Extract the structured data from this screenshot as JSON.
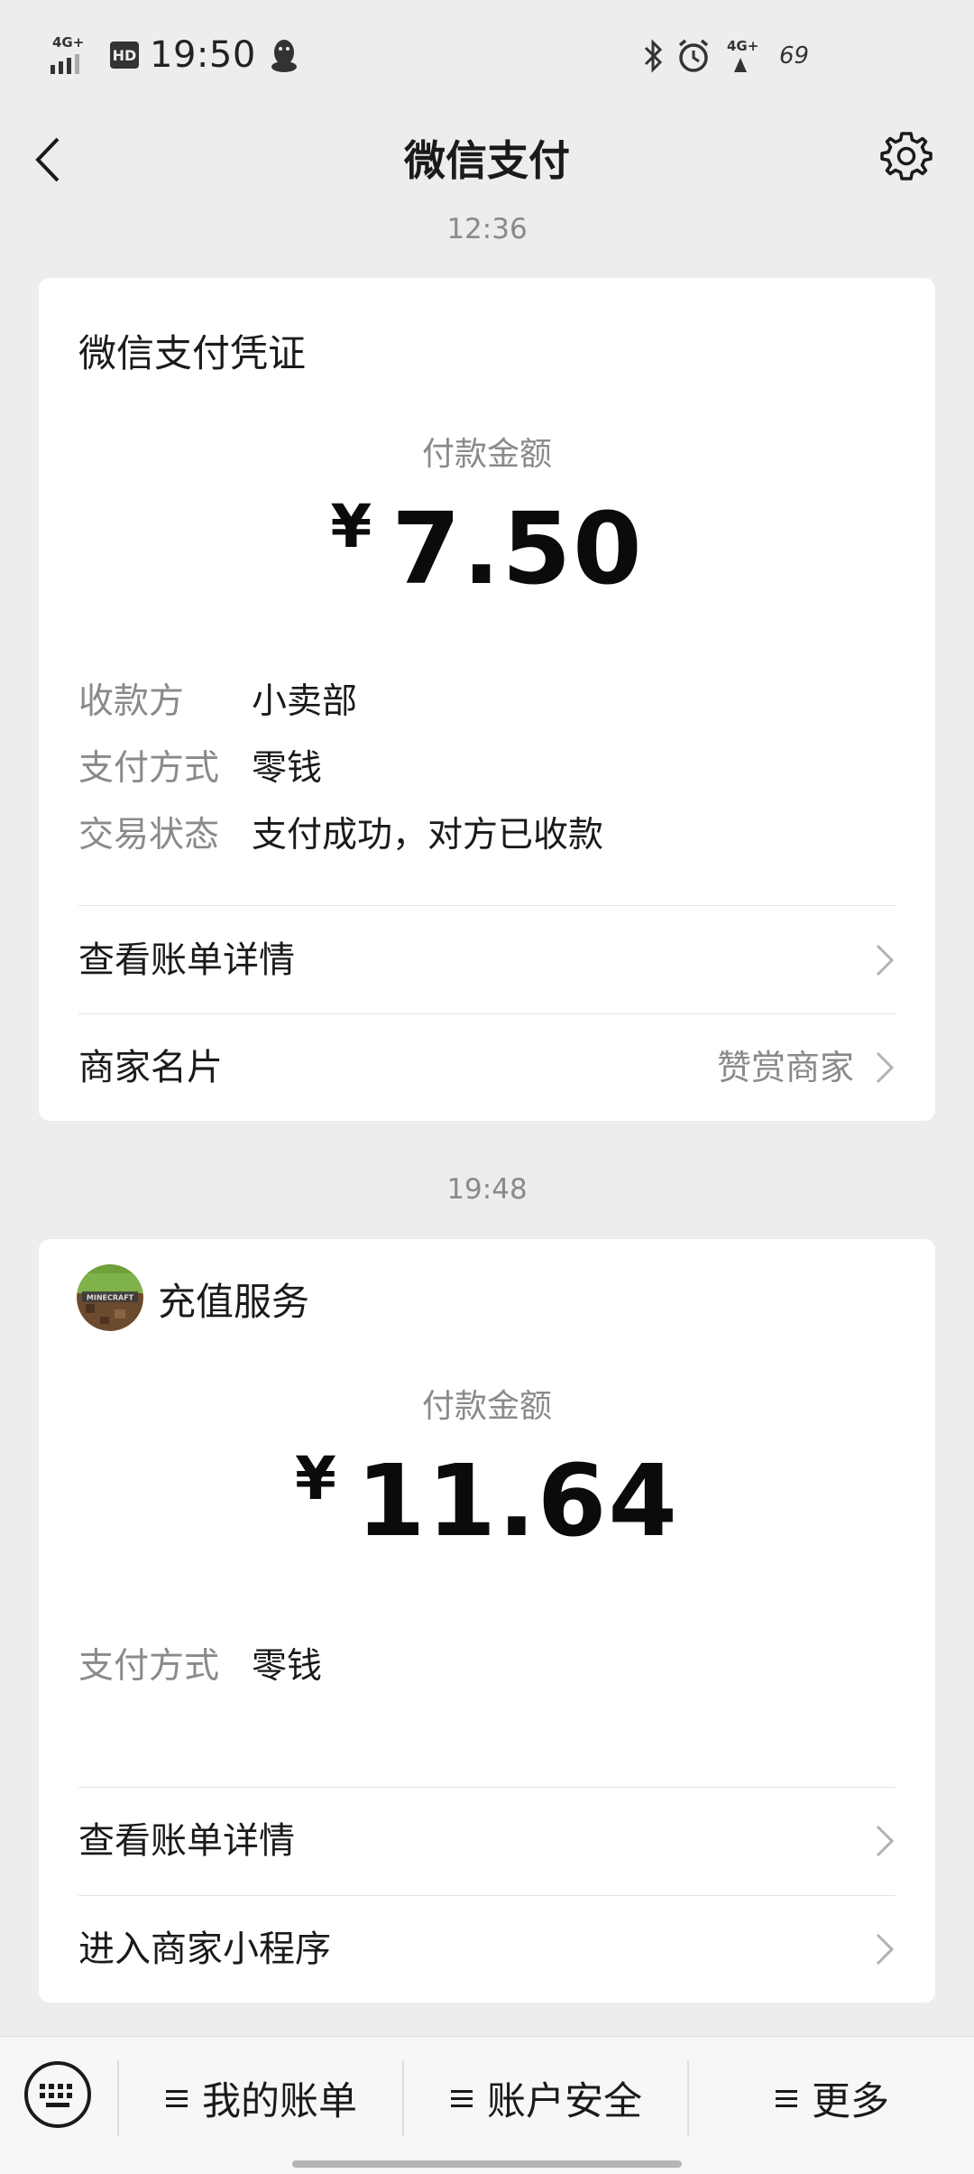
{
  "status_bar": {
    "network_left": "4G+",
    "hd_badge": "HD",
    "time": "19:50",
    "network_right": "4G+",
    "battery": "69",
    "icons": [
      "signal-icon",
      "hd-icon",
      "qq-icon",
      "bluetooth-icon",
      "alarm-icon",
      "signal-icon",
      "battery-icon"
    ]
  },
  "nav": {
    "title": "微信支付",
    "back_icon": "chevron-left-icon",
    "settings_icon": "gear-icon"
  },
  "messages": [
    {
      "time": "12:36",
      "title": "微信支付凭证",
      "amount_label": "付款金额",
      "currency": "¥",
      "amount": "7.50",
      "details": [
        {
          "key": "收款方",
          "value": "小卖部"
        },
        {
          "key": "支付方式",
          "value": "零钱"
        },
        {
          "key": "交易状态",
          "value": "支付成功，对方已收款"
        }
      ],
      "links": [
        {
          "label": "查看账单详情",
          "extra": ""
        },
        {
          "label": "商家名片",
          "extra": "赞赏商家"
        }
      ]
    },
    {
      "time": "19:48",
      "title": "充值服务",
      "avatar_text": "MINECRAFT",
      "amount_label": "付款金额",
      "currency": "¥",
      "amount": "11.64",
      "details": [
        {
          "key": "支付方式",
          "value": "零钱"
        }
      ],
      "links": [
        {
          "label": "查看账单详情",
          "extra": ""
        },
        {
          "label": "进入商家小程序",
          "extra": ""
        }
      ]
    }
  ],
  "bottom_menu": {
    "keyboard_icon": "keyboard-icon",
    "items": [
      {
        "label": "我的账单"
      },
      {
        "label": "账户安全"
      },
      {
        "label": "更多"
      }
    ]
  },
  "colors": {
    "background": "#ededed",
    "card": "#ffffff",
    "secondary_text": "#8a8a8a",
    "primary_text": "#1a1a1a"
  }
}
